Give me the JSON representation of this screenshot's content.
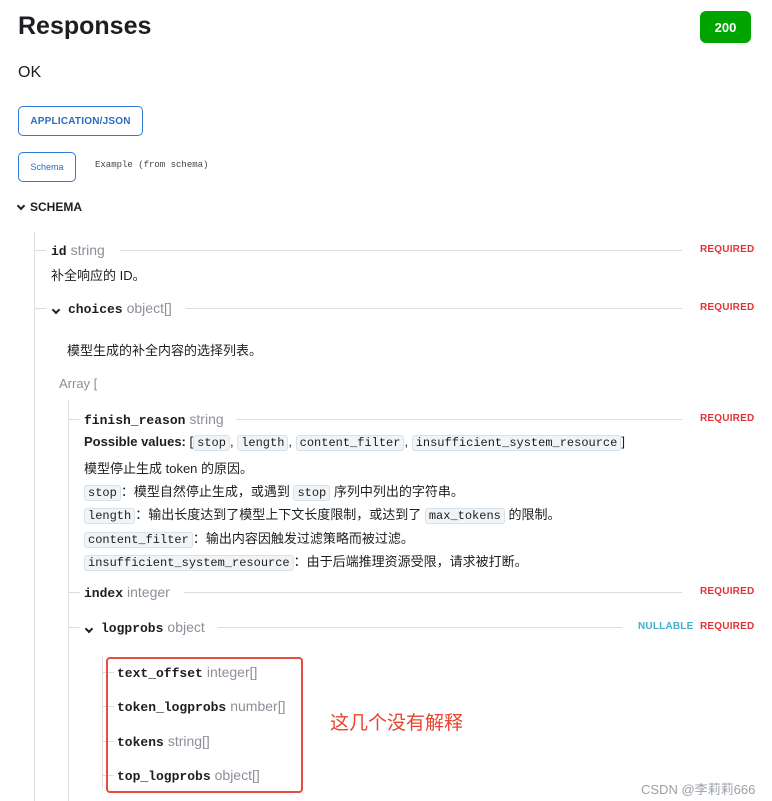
{
  "header": {
    "title": "Responses",
    "status_code": "200",
    "description": "OK"
  },
  "content_type": {
    "label": "APPLICATION/JSON"
  },
  "tabs": {
    "schema": "Schema",
    "example": "Example (from schema)"
  },
  "schema": {
    "label": "SCHEMA",
    "id": {
      "name": "id",
      "type": "string",
      "required": "REQUIRED",
      "description": "补全响应的 ID。"
    },
    "choices": {
      "name": "choices",
      "type": "object[]",
      "required": "REQUIRED",
      "description": "模型生成的补全内容的选择列表。",
      "array_open": "Array [",
      "finish_reason": {
        "name": "finish_reason",
        "type": "string",
        "required": "REQUIRED",
        "possible_values_label": "Possible values:",
        "values": [
          "stop",
          "length",
          "content_filter",
          "insufficient_system_resource"
        ],
        "description": "模型停止生成 token 的原因。",
        "details": [
          {
            "code": "stop",
            "text_a": "：模型自然停止生成，或遇到 ",
            "code2": "stop",
            "text_b": " 序列中列出的字符串。"
          },
          {
            "code": "length",
            "text_a": "：输出长度达到了模型上下文长度限制，或达到了 ",
            "code2": "max_tokens",
            "text_b": " 的限制。"
          },
          {
            "code": "content_filter",
            "text_a": "：输出内容因触发过滤策略而被过滤。"
          },
          {
            "code": "insufficient_system_resource",
            "text_a": "：由于后端推理资源受限，请求被打断。"
          }
        ]
      },
      "index": {
        "name": "index",
        "type": "integer",
        "required": "REQUIRED"
      },
      "logprobs": {
        "name": "logprobs",
        "type": "object",
        "nullable": "NULLABLE",
        "required": "REQUIRED",
        "fields": [
          {
            "name": "text_offset",
            "type": "integer[]"
          },
          {
            "name": "token_logprobs",
            "type": "number[]"
          },
          {
            "name": "tokens",
            "type": "string[]"
          },
          {
            "name": "top_logprobs",
            "type": "object[]"
          }
        ]
      }
    }
  },
  "annotation": {
    "note": "这几个没有解释"
  },
  "watermark": "CSDN @李莉莉666",
  "colors": {
    "required": "#e13238",
    "nullable": "#3fb0d0",
    "status": "#00a400",
    "annotation": "#e84c3d",
    "link": "#2a6bbf"
  }
}
